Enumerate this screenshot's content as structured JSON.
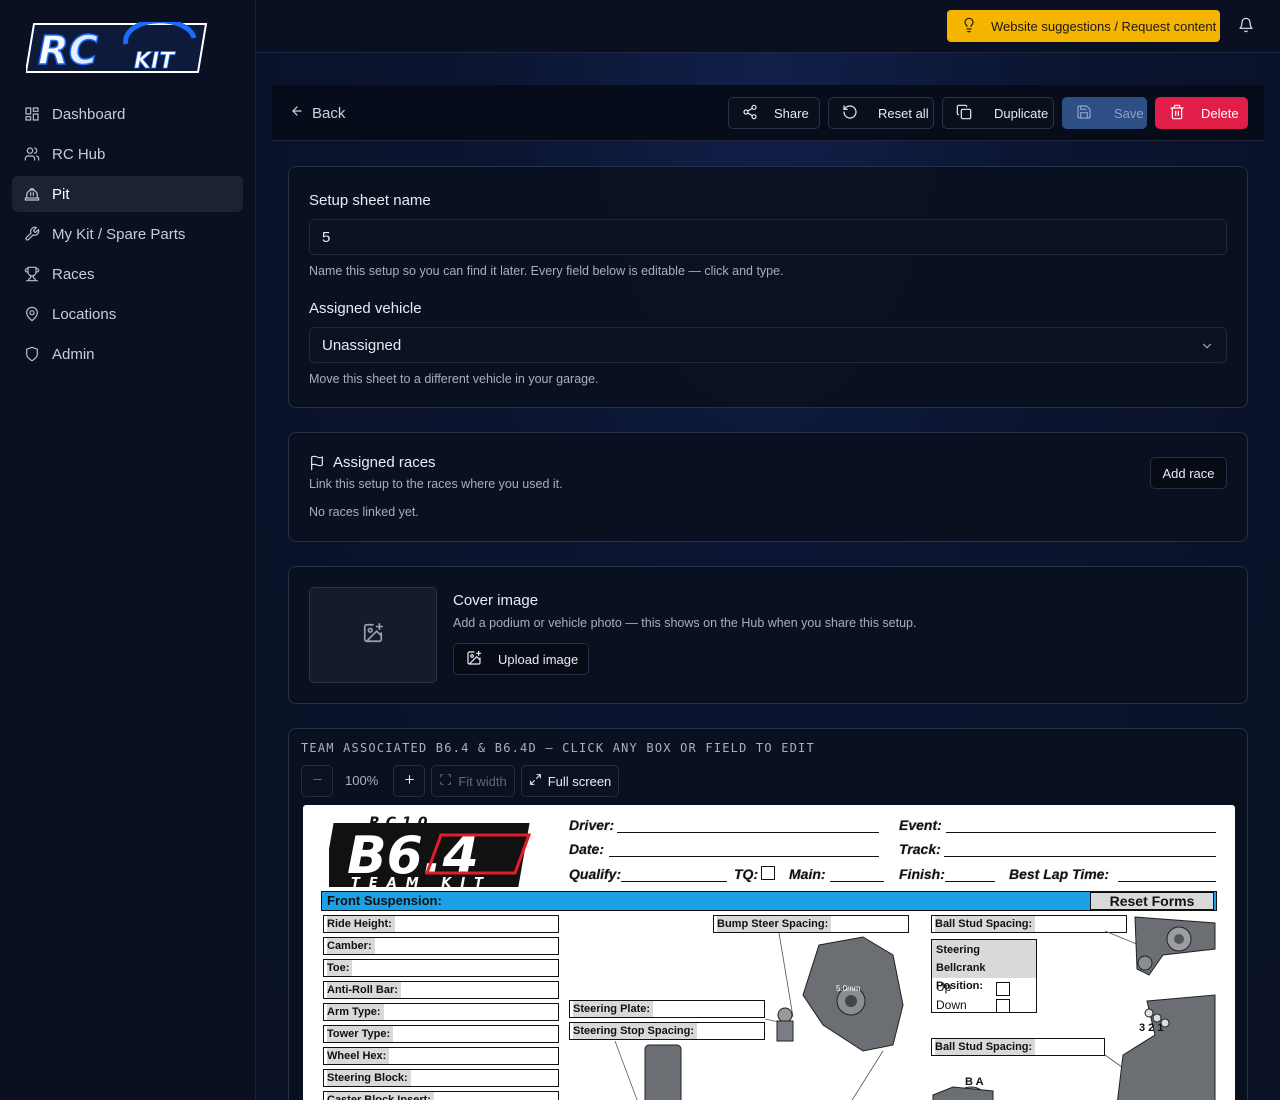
{
  "sidebar": {
    "logo": "RC KIT",
    "items": [
      {
        "label": "Dashboard",
        "icon": "dashboard-icon"
      },
      {
        "label": "RC Hub",
        "icon": "users-icon"
      },
      {
        "label": "Pit",
        "icon": "hardhat-icon",
        "active": true
      },
      {
        "label": "My Kit / Spare Parts",
        "icon": "wrench-icon"
      },
      {
        "label": "Races",
        "icon": "trophy-icon"
      },
      {
        "label": "Locations",
        "icon": "map-pin-icon"
      },
      {
        "label": "Admin",
        "icon": "shield-icon"
      }
    ]
  },
  "topbar": {
    "suggest_label": "Website suggestions / Request content",
    "suggest_color": "#f5b400"
  },
  "toolbar": {
    "back_label": "Back",
    "share_label": "Share",
    "reset_label": "Reset all",
    "duplicate_label": "Duplicate",
    "save_label": "Save",
    "delete_label": "Delete"
  },
  "details": {
    "name_label": "Setup sheet name",
    "name_value": "5",
    "name_hint": "Name this setup so you can find it later. Every field below is editable — click and type.",
    "vehicle_label": "Assigned vehicle",
    "vehicle_value": "Unassigned",
    "vehicle_hint": "Move this sheet to a different vehicle in your garage."
  },
  "races": {
    "title": "Assigned races",
    "subtitle": "Link this setup to the races where you used it.",
    "empty": "No races linked yet.",
    "add_label": "Add race"
  },
  "cover": {
    "title": "Cover image",
    "subtitle": "Add a podium or vehicle photo — this shows on the Hub when you share this setup.",
    "upload_label": "Upload image"
  },
  "sheet": {
    "title": "TEAM ASSOCIATED B6.4 & B6.4D — CLICK ANY BOX OR FIELD TO EDIT",
    "zoom": "100%",
    "fit_label": "Fit width",
    "fullscreen_label": "Full screen",
    "brand_top": "RC10",
    "brand_main": "B6.4",
    "brand_sub": "TEAM KIT",
    "header_fields": {
      "driver": "Driver:",
      "date": "Date:",
      "qualify": "Qualify:",
      "tq": "TQ:",
      "main": "Main:",
      "event": "Event:",
      "track": "Track:",
      "finish": "Finish:",
      "best_lap": "Best Lap Time:"
    },
    "section": "Front Suspension:",
    "reset_forms": "Reset Forms",
    "left_fields": [
      "Ride Height:",
      "Camber:",
      "Toe:",
      "Anti-Roll Bar:",
      "Arm Type:",
      "Tower Type:",
      "Wheel Hex:",
      "Steering Block:",
      "Caster Block Insert:"
    ],
    "bump_steer": "Bump Steer Spacing:",
    "steering_plate": "Steering Plate:",
    "steering_stop": "Steering Stop Spacing:",
    "ball_stud_1": "Ball Stud Spacing:",
    "ball_stud_2": "Ball Stud Spacing:",
    "bellcrank_title": "Steering Bellcrank Position:",
    "bellcrank_up": "Up",
    "bellcrank_down": "Down",
    "diagram_dim": "5.0mm",
    "diagram_nums": "3 2 1",
    "diagram_ba": "B A",
    "accent_blue": "#1da1e6"
  }
}
